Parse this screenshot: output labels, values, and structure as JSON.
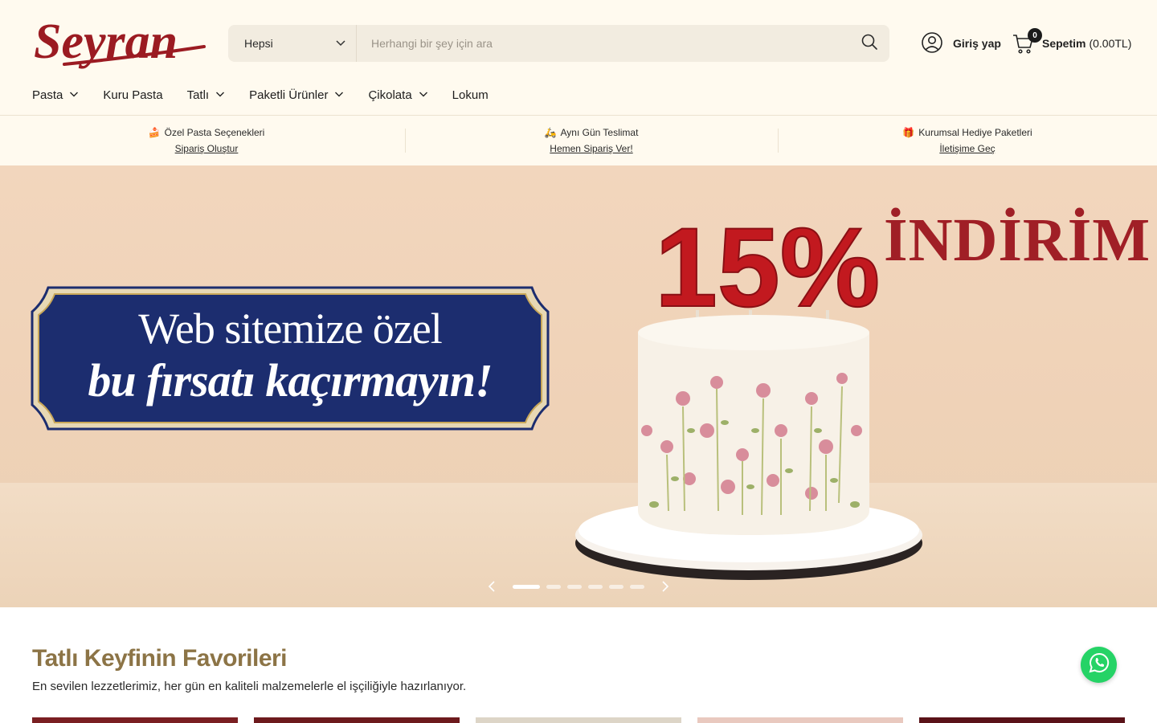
{
  "header": {
    "logo_text": "Seyran",
    "search": {
      "category": "Hepsi",
      "placeholder": "Herhangi bir şey için ara",
      "value": ""
    },
    "account_label": "Giriş yap",
    "cart": {
      "count": "0",
      "label": "Sepetim",
      "total": "(0.00TL)"
    }
  },
  "nav": {
    "items": [
      {
        "label": "Pasta",
        "dropdown": true
      },
      {
        "label": "Kuru Pasta",
        "dropdown": false
      },
      {
        "label": "Tatlı",
        "dropdown": true
      },
      {
        "label": "Paketli Ürünler",
        "dropdown": true
      },
      {
        "label": "Çikolata",
        "dropdown": true
      },
      {
        "label": "Lokum",
        "dropdown": false
      }
    ]
  },
  "features": [
    {
      "emoji": "🍰",
      "title": "Özel Pasta Seçenekleri",
      "link": "Sipariş Oluştur"
    },
    {
      "emoji": "🛵",
      "title": "Aynı Gün Teslimat",
      "link": "Hemen Sipariş Ver!"
    },
    {
      "emoji": "🎁",
      "title": "Kurumsal Hediye Paketleri",
      "link": "İletişime Geç"
    }
  ],
  "hero": {
    "promo_text": "İNDİRİM",
    "candle_text": "15%",
    "banner_line1": "Web sitemize özel",
    "banner_line2": "bu fırsatı kaçırmayın!",
    "slides_count": 6,
    "active_slide": 1
  },
  "section": {
    "title": "Tatlı Keyfinin Favorileri",
    "subtitle": "En sevilen lezzetlerimiz, her gün en kaliteli malzemelerle el işçiliğiyle hazırlanıyor."
  },
  "colors": {
    "header_bg": "#fffaef",
    "brand_red": "#9b1b22",
    "section_gold": "#8c7446",
    "banner_navy": "#1c2d6f",
    "whatsapp_green": "#25d366"
  },
  "icons": {
    "account": "user-circle-icon",
    "cart": "shopping-cart-icon",
    "search": "search-icon",
    "whatsapp": "whatsapp-icon"
  }
}
